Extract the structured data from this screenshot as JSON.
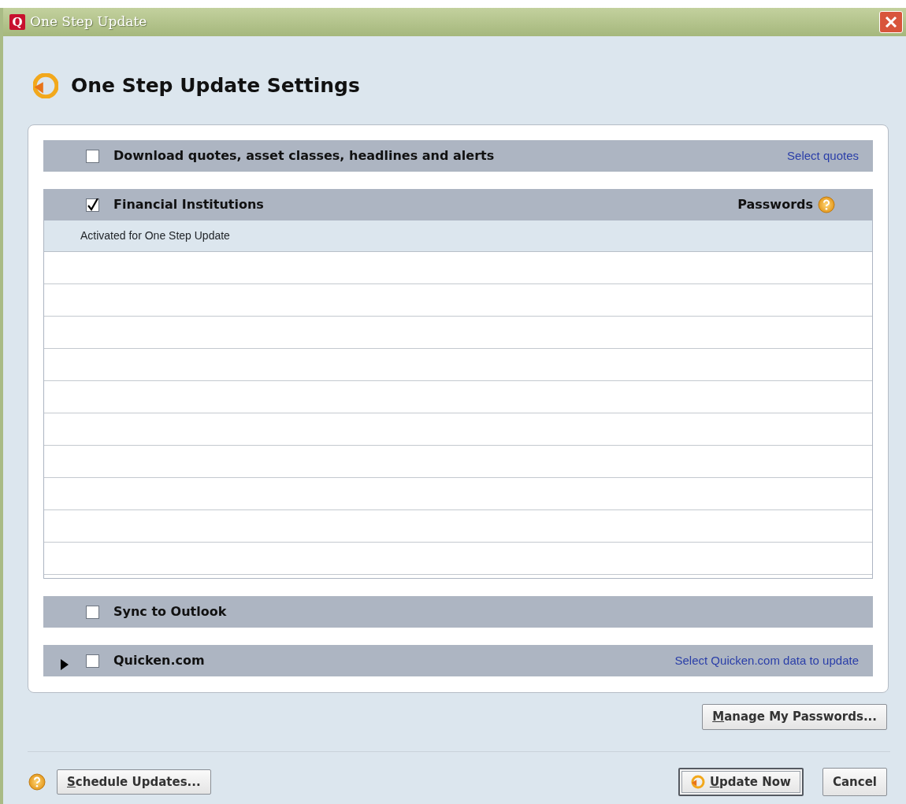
{
  "window": {
    "logo_letter": "Q",
    "title": "One Step Update"
  },
  "heading": "One Step Update Settings",
  "sections": [
    {
      "kind": "plain",
      "label": "Download quotes, asset classes, headlines and alerts",
      "checked": false,
      "link": "Select quotes"
    },
    {
      "kind": "list",
      "label": "Financial Institutions",
      "checked": true,
      "right_label": "Passwords",
      "list_header": "Activated for One Step Update"
    },
    {
      "kind": "plain",
      "label": "Sync to Outlook",
      "checked": false
    },
    {
      "kind": "expandable",
      "label": "Quicken.com",
      "checked": false,
      "expanded": false,
      "link": "Select Quicken.com data to update"
    }
  ],
  "manage_button": {
    "label": "Manage My Passwords...",
    "access_key_underlined": true
  },
  "footer": {
    "left_buttons": [
      {
        "label": "Schedule Updates...",
        "access_key_underlined": true,
        "default": false
      }
    ],
    "right_buttons": [
      {
        "label": "Update Now",
        "access_key_underlined": true,
        "default": true,
        "icon": true
      },
      {
        "label": "Cancel",
        "access_key_underlined": false,
        "default": false
      }
    ]
  }
}
